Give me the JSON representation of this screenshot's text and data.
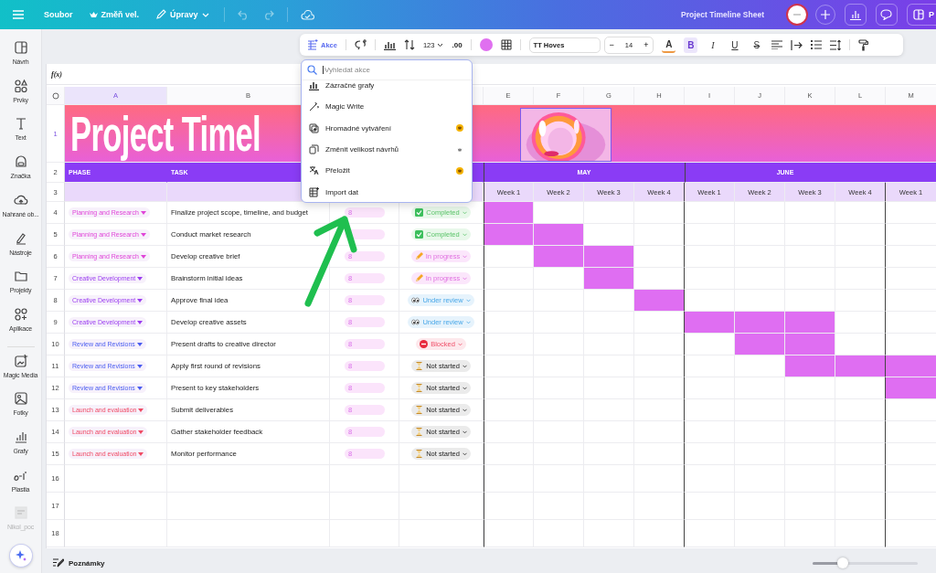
{
  "top_bar": {
    "items": [
      {
        "kind": "file",
        "label": "Soubor"
      },
      {
        "kind": "resize",
        "label": "Změň vel."
      },
      {
        "kind": "edit",
        "label": "Úpravy"
      }
    ],
    "title": "Project Timeline Sheet",
    "share_label": "P"
  },
  "sidebar": {
    "items": [
      {
        "kind": "design",
        "label": "Návrh",
        "disabled": false
      },
      {
        "kind": "elements",
        "label": "Prvky",
        "disabled": false
      },
      {
        "kind": "text",
        "label": "Text",
        "disabled": false
      },
      {
        "kind": "brand",
        "label": "Značka",
        "disabled": false
      },
      {
        "kind": "upload",
        "label": "Nahrané ob...",
        "disabled": false
      },
      {
        "kind": "tools",
        "label": "Nástroje",
        "disabled": false
      },
      {
        "kind": "projects",
        "label": "Projekty",
        "disabled": false
      },
      {
        "kind": "apps",
        "label": "Aplikace",
        "disabled": false
      },
      {
        "kind": "magic",
        "label": "Magic Media",
        "disabled": false
      },
      {
        "kind": "photos",
        "label": "Fotky",
        "disabled": false
      },
      {
        "kind": "charts",
        "label": "Grafy",
        "disabled": false
      },
      {
        "kind": "plastia",
        "label": "Plastia",
        "disabled": false
      },
      {
        "kind": "user",
        "label": "Nikol_poc",
        "disabled": true
      }
    ]
  },
  "toolbar": {
    "actions_label": "Akce",
    "number_format": "123",
    "decimals": ".00",
    "font": "TT Hoves",
    "minus": "−",
    "font_size": "14",
    "plus": "+",
    "text_color_label": "A",
    "bold_label": "B",
    "bold": true,
    "italic_label": "I",
    "underline_label": "U",
    "strike_label": "S"
  },
  "formula_bar": {
    "label": "f(x)"
  },
  "sheet": {
    "column_headers_left": [
      {
        "label": "A",
        "selected": true
      },
      {
        "label": "B",
        "selected": false
      }
    ],
    "column_headers_right": [
      "E",
      "F",
      "G",
      "H",
      "I",
      "J",
      "K",
      "L",
      "M"
    ],
    "title_row": {
      "number": "1",
      "title": "Project Timel"
    },
    "header_row": {
      "number": "2",
      "phase": "PHASE",
      "task": "TASK",
      "months": [
        "MAY",
        "JUNE"
      ]
    },
    "week_row": {
      "number": "3",
      "weeks": [
        "Week 1",
        "Week 2",
        "Week 3",
        "Week 4",
        "Week 1",
        "Week 2",
        "Week 3",
        "Week 4",
        "Week 1"
      ]
    },
    "rows": [
      {
        "number": "4",
        "phase": "Planning and Research",
        "color": "#e044d8",
        "task": "Finalize project scope, timeline, and budget",
        "duration": "8",
        "status": {
          "kind": "completed",
          "label": "Completed"
        },
        "gantt": [
          true,
          false,
          false,
          false,
          false,
          false,
          false,
          false,
          false
        ]
      },
      {
        "number": "5",
        "phase": "Planning and Research",
        "color": "#e044d8",
        "task": "Conduct market research",
        "status": {
          "kind": "completed",
          "label": "Completed"
        },
        "gantt": [
          true,
          true,
          false,
          false,
          false,
          false,
          false,
          false,
          false
        ]
      },
      {
        "number": "6",
        "phase": "Planning and Research",
        "color": "#e044d8",
        "task": "Develop creative brief",
        "duration": "8",
        "status": {
          "kind": "in_progress",
          "label": "In progress"
        },
        "gantt": [
          false,
          true,
          true,
          false,
          false,
          false,
          false,
          false,
          false
        ]
      },
      {
        "number": "7",
        "phase": "Creative Development",
        "color": "#9b3df0",
        "task": "Brainstorm initial ideas",
        "duration": "8",
        "status": {
          "kind": "in_progress",
          "label": "In progress"
        },
        "gantt": [
          false,
          false,
          true,
          false,
          false,
          false,
          false,
          false,
          false
        ]
      },
      {
        "number": "8",
        "phase": "Creative Development",
        "color": "#9b3df0",
        "task": "Approve final idea",
        "duration": "8",
        "status": {
          "kind": "under_review",
          "label": "Under review"
        },
        "gantt": [
          false,
          false,
          false,
          true,
          false,
          false,
          false,
          false,
          false
        ]
      },
      {
        "number": "9",
        "phase": "Creative Development",
        "color": "#9b3df0",
        "task": "Develop creative assets",
        "duration": "8",
        "status": {
          "kind": "under_review",
          "label": "Under review"
        },
        "gantt": [
          false,
          false,
          false,
          false,
          true,
          true,
          true,
          false,
          false
        ]
      },
      {
        "number": "10",
        "phase": "Review and Revisions",
        "color": "#4a5cf0",
        "task": "Present drafts to creative director",
        "duration": "8",
        "status": {
          "kind": "blocked",
          "label": "Blocked"
        },
        "gantt": [
          false,
          false,
          false,
          false,
          false,
          true,
          true,
          false,
          false
        ]
      },
      {
        "number": "11",
        "phase": "Review and Revisions",
        "color": "#4a5cf0",
        "task": "Apply first round of revisions",
        "duration": "8",
        "status": {
          "kind": "not_started",
          "label": "Not started"
        },
        "gantt": [
          false,
          false,
          false,
          false,
          false,
          false,
          true,
          true,
          true
        ]
      },
      {
        "number": "12",
        "phase": "Review and Revisions",
        "color": "#4a5cf0",
        "task": "Present to key stakeholders",
        "duration": "8",
        "status": {
          "kind": "not_started",
          "label": "Not started"
        },
        "gantt": [
          false,
          false,
          false,
          false,
          false,
          false,
          false,
          false,
          true
        ]
      },
      {
        "number": "13",
        "phase": "Launch and evaluation",
        "color": "#f04a64",
        "task": "Submit deliverables",
        "duration": "8",
        "status": {
          "kind": "not_started",
          "label": "Not started"
        },
        "gantt": [
          false,
          false,
          false,
          false,
          false,
          false,
          false,
          false,
          false
        ]
      },
      {
        "number": "14",
        "phase": "Launch and evaluation",
        "color": "#f04a64",
        "task": "Gather stakeholder feedback",
        "duration": "8",
        "status": {
          "kind": "not_started",
          "label": "Not started"
        },
        "gantt": [
          false,
          false,
          false,
          false,
          false,
          false,
          false,
          false,
          false
        ]
      },
      {
        "number": "15",
        "phase": "Launch and evaluation",
        "color": "#f04a64",
        "task": "Monitor performance",
        "duration": "8",
        "status": {
          "kind": "not_started",
          "label": "Not started"
        },
        "gantt": [
          false,
          false,
          false,
          false,
          false,
          false,
          false,
          false,
          false
        ]
      }
    ],
    "empty_rows": [
      "16",
      "17",
      "18"
    ]
  },
  "actions_menu": {
    "placeholder": "Vyhledat akce",
    "items": [
      {
        "kind": "charts",
        "label": "Zázračné grafy"
      },
      {
        "kind": "write",
        "label": "Magic Write"
      },
      {
        "kind": "bulk",
        "label": "Hromadné vytváření",
        "premium": true,
        "highlighted": true
      },
      {
        "kind": "resize",
        "label": "Změnit velikost návrhů",
        "premium": true,
        "highlighted": false
      },
      {
        "kind": "translate",
        "label": "Přeložit",
        "premium": true,
        "highlighted": true
      },
      {
        "kind": "import",
        "label": "Import dat"
      }
    ]
  },
  "footer": {
    "notes_label": "Poznámky",
    "zoom": {
      "level": 0.29
    }
  }
}
